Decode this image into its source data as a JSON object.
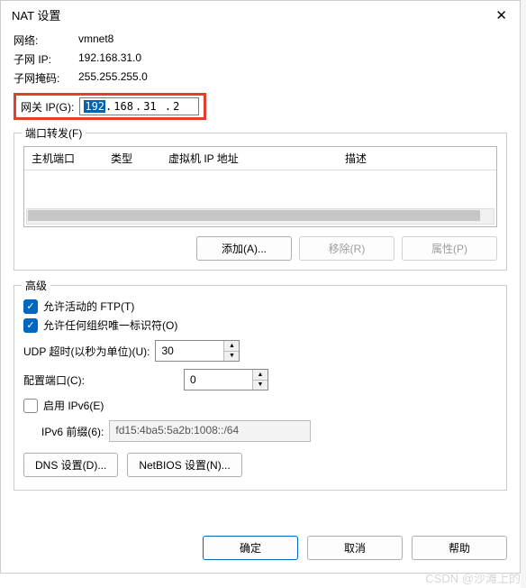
{
  "dialog": {
    "title": "NAT 设置"
  },
  "info": {
    "network_label": "网络:",
    "network_value": "vmnet8",
    "subnet_ip_label": "子网 IP:",
    "subnet_ip_value": "192.168.31.0",
    "subnet_mask_label": "子网掩码:",
    "subnet_mask_value": "255.255.255.0"
  },
  "gateway": {
    "label": "网关 IP(G):",
    "octet1": "192",
    "octet2": "168",
    "octet3": "31",
    "octet4": "2"
  },
  "port_forwarding": {
    "group_title": "端口转发(F)",
    "col_host_port": "主机端口",
    "col_type": "类型",
    "col_vm_ip": "虚拟机 IP 地址",
    "col_desc": "描述",
    "btn_add": "添加(A)...",
    "btn_remove": "移除(R)",
    "btn_props": "属性(P)"
  },
  "advanced": {
    "group_title": "高级",
    "ftp_label": "允许活动的 FTP(T)",
    "org_id_label": "允许任何组织唯一标识符(O)",
    "udp_timeout_label": "UDP 超时(以秒为单位)(U):",
    "udp_timeout_value": "30",
    "config_port_label": "配置端口(C):",
    "config_port_value": "0",
    "ipv6_enable_label": "启用 IPv6(E)",
    "ipv6_prefix_label": "IPv6 前缀(6):",
    "ipv6_prefix_value": "fd15:4ba5:5a2b:1008::/64",
    "btn_dns": "DNS 设置(D)...",
    "btn_netbios": "NetBIOS 设置(N)..."
  },
  "footer": {
    "ok": "确定",
    "cancel": "取消",
    "help": "帮助"
  },
  "watermark": "CSDN @沙滩上的"
}
